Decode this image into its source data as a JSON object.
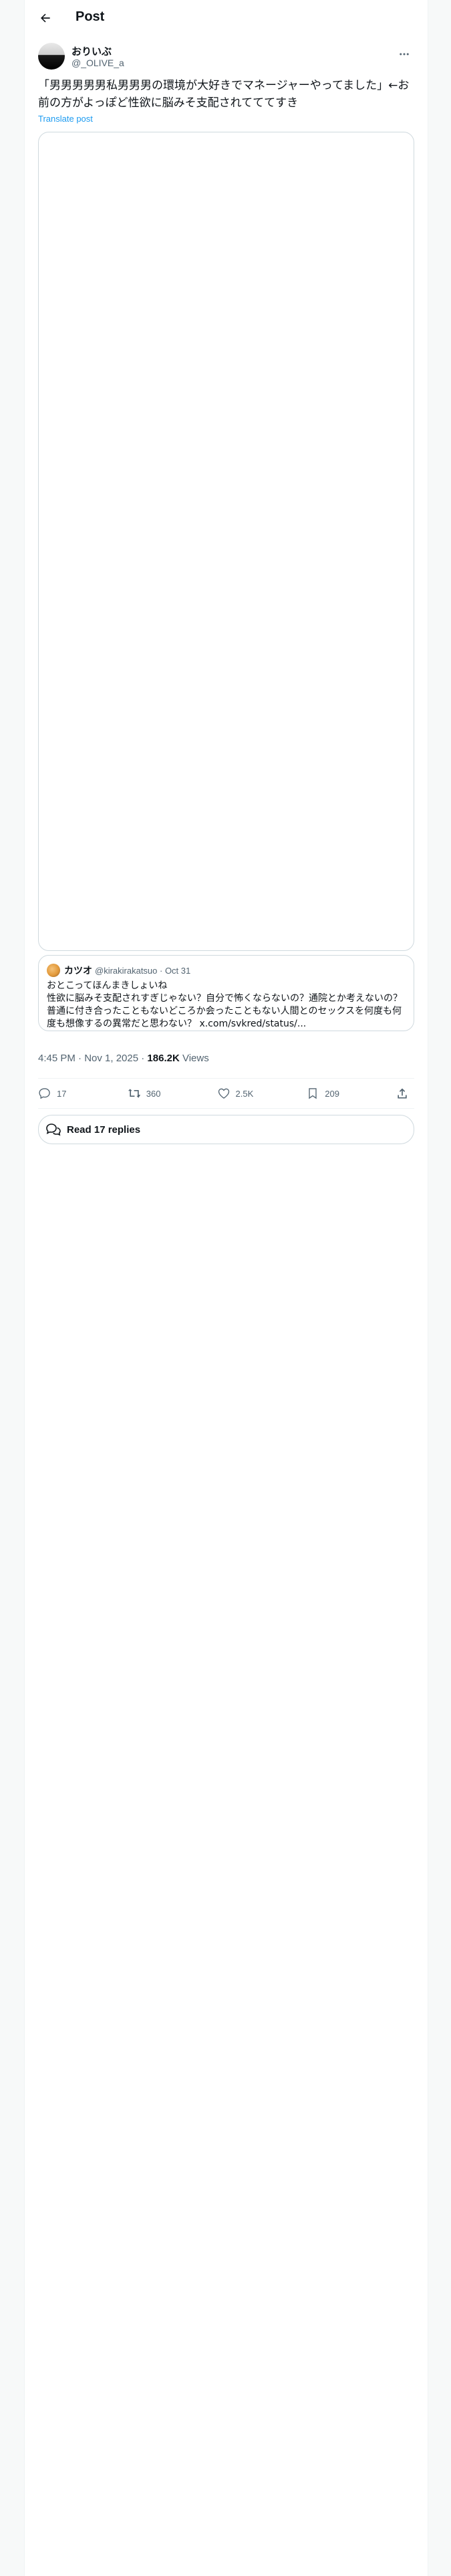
{
  "header": {
    "title": "Post"
  },
  "author": {
    "name": "おりいぶ",
    "handle": "@_OLIVE_a"
  },
  "tweet": {
    "text": "「男男男男男私男男男の環境が大好きでマネージャーやってました」←お前の方がよっぽど性欲に脳みそ支配されてててすき",
    "translate_label": "Translate post"
  },
  "quote": {
    "name": "カツオ",
    "meta": "@kirakirakatsuo · Oct 31",
    "text": "おとこってほんまきしょいね\n性欲に脳みそ支配されすぎじゃない？自分で怖くならないの？通院とか考えないの？普通に付き合ったこともないどころか会ったこともない人間とのセックスを何度も何度も想像するの異常だと思わない？ x.com/svkred/status/..."
  },
  "meta": {
    "time_date": "4:45 PM · Nov 1, 2025 · ",
    "views_count": "186.2K",
    "views_label": " Views"
  },
  "actions": {
    "replies": "17",
    "reposts": "360",
    "likes": "2.5K",
    "bookmarks": "209"
  },
  "read_replies": "Read 17 replies",
  "icons": [
    "back-arrow-icon",
    "more-icon",
    "reply-icon",
    "repost-icon",
    "like-icon",
    "bookmark-icon",
    "share-icon",
    "speech-bubbles-icon"
  ]
}
